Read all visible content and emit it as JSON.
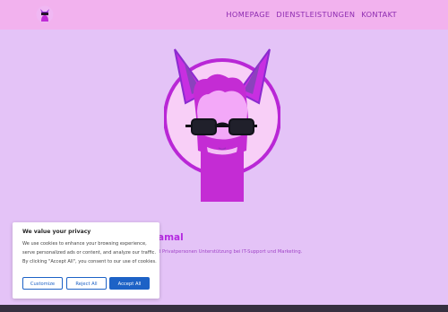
{
  "nav": {
    "items": [
      {
        "label": "HOMEPAGE"
      },
      {
        "label": "DIENSTLEISTUNGEN"
      },
      {
        "label": "KONTAKT"
      }
    ]
  },
  "hero": {
    "heading_visible": "amal",
    "sub_visible": "d Privatpersonen Unterstützung bei IT-Support und Marketing."
  },
  "cookie": {
    "title": "We value your privacy",
    "body": "We use cookies to enhance your browsing experience, serve personalized ads or content, and analyze our traffic. By clicking \"Accept All\", you consent to our use of cookies.",
    "customize_label": "Customize",
    "reject_label": "Reject All",
    "accept_label": "Accept All"
  },
  "colors": {
    "page_bg": "#e4c3f7",
    "header_bg": "#f2b2ee",
    "nav_text": "#8d2bb0",
    "accent_magenta": "#b42ae0",
    "button_blue": "#1d62c6",
    "footer_bg": "#363040"
  },
  "icons": {
    "logo": "llama-logo-icon",
    "hero": "llama-sunglasses-illustration"
  }
}
